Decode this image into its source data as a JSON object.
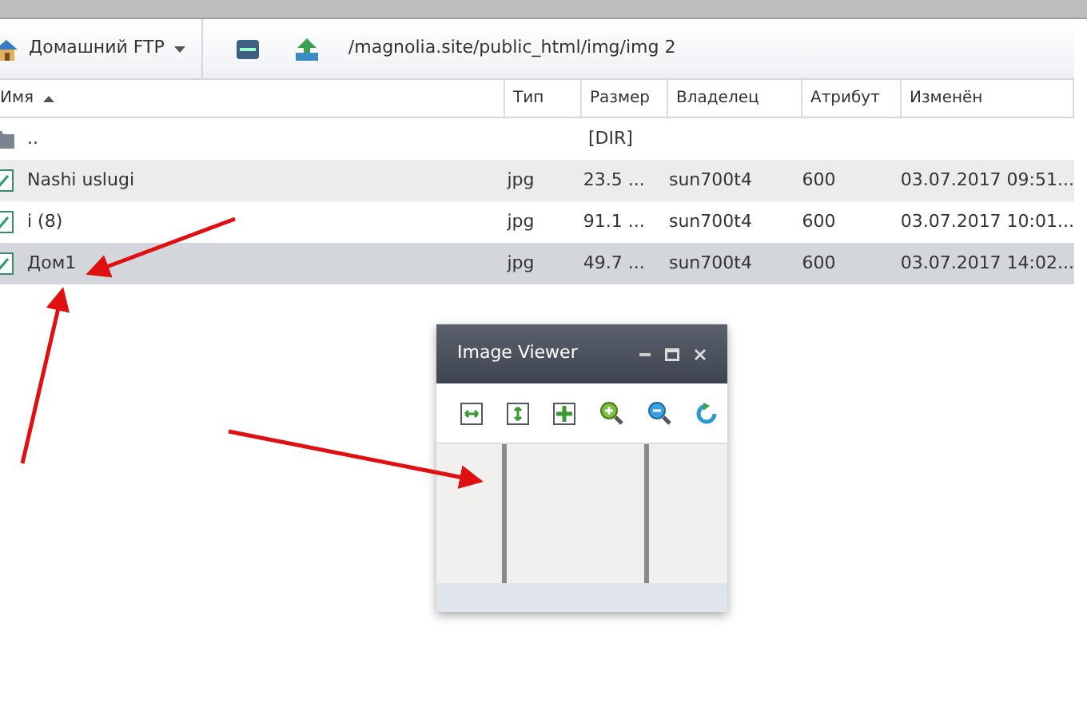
{
  "toolbar": {
    "location": "Домашний FTP",
    "path": "/magnolia.site/public_html/img/img 2"
  },
  "columns": [
    {
      "label": "Имя",
      "sorted": true
    },
    {
      "label": "Тип",
      "sorted": false
    },
    {
      "label": "Размер",
      "sorted": false
    },
    {
      "label": "Владелец",
      "sorted": false
    },
    {
      "label": "Атрибут",
      "sorted": false
    },
    {
      "label": "Изменён",
      "sorted": false
    }
  ],
  "rows": [
    {
      "kind": "folder",
      "name": "..",
      "type": "",
      "size": "[DIR]",
      "owner": "",
      "attr": "",
      "modified": "",
      "selected": false
    },
    {
      "kind": "file",
      "name": "Nashi uslugi",
      "type": "jpg",
      "size": "23.5 ...",
      "owner": "sun700t4",
      "attr": "600",
      "modified": "03.07.2017 09:51...",
      "selected": false
    },
    {
      "kind": "file",
      "name": "i (8)",
      "type": "jpg",
      "size": "91.1 ...",
      "owner": "sun700t4",
      "attr": "600",
      "modified": "03.07.2017 10:01...",
      "selected": false
    },
    {
      "kind": "file",
      "name": "Дом1",
      "type": "jpg",
      "size": "49.7 ...",
      "owner": "sun700t4",
      "attr": "600",
      "modified": "03.07.2017 14:02...",
      "selected": true
    }
  ],
  "image_viewer": {
    "title": "Image Viewer"
  }
}
